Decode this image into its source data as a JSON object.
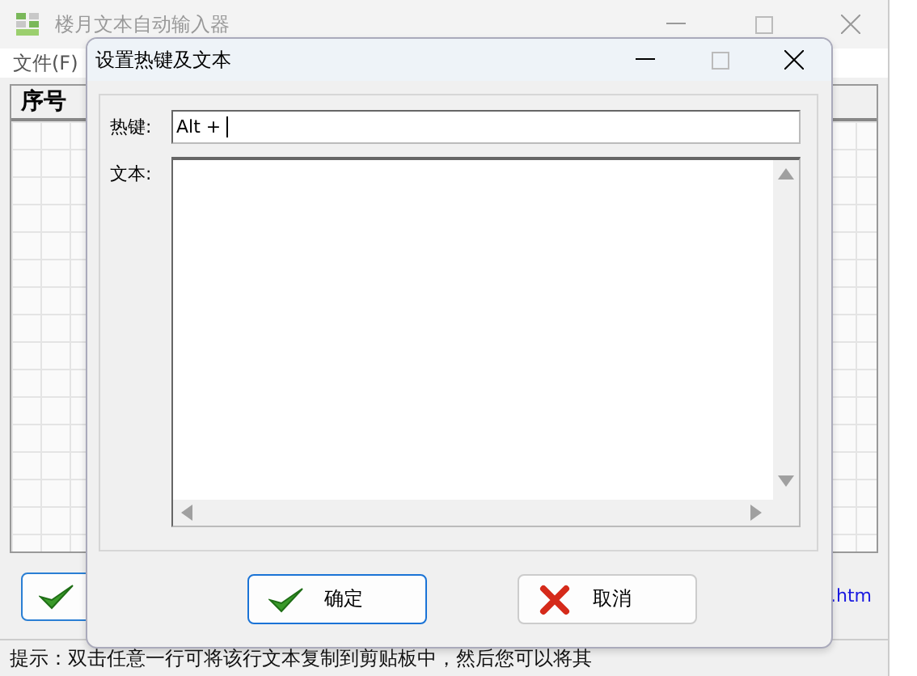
{
  "main_window": {
    "title": "楼月文本自动输入器",
    "menu": [
      "文件(F)"
    ],
    "table": {
      "columns": [
        "序号"
      ]
    },
    "link": ".htm",
    "status_bar": "提示：双击任意一行可将该行文本复制到剪贴板中，然后您可以将其"
  },
  "dialog": {
    "title": "设置热键及文本",
    "hotkey": {
      "label": "热键:",
      "value": "Alt +"
    },
    "text": {
      "label": "文本:"
    },
    "buttons": [
      {
        "label": "确定",
        "kind": "ok",
        "selected": true
      },
      {
        "label": "取消",
        "kind": "cancel",
        "selected": false
      }
    ]
  }
}
